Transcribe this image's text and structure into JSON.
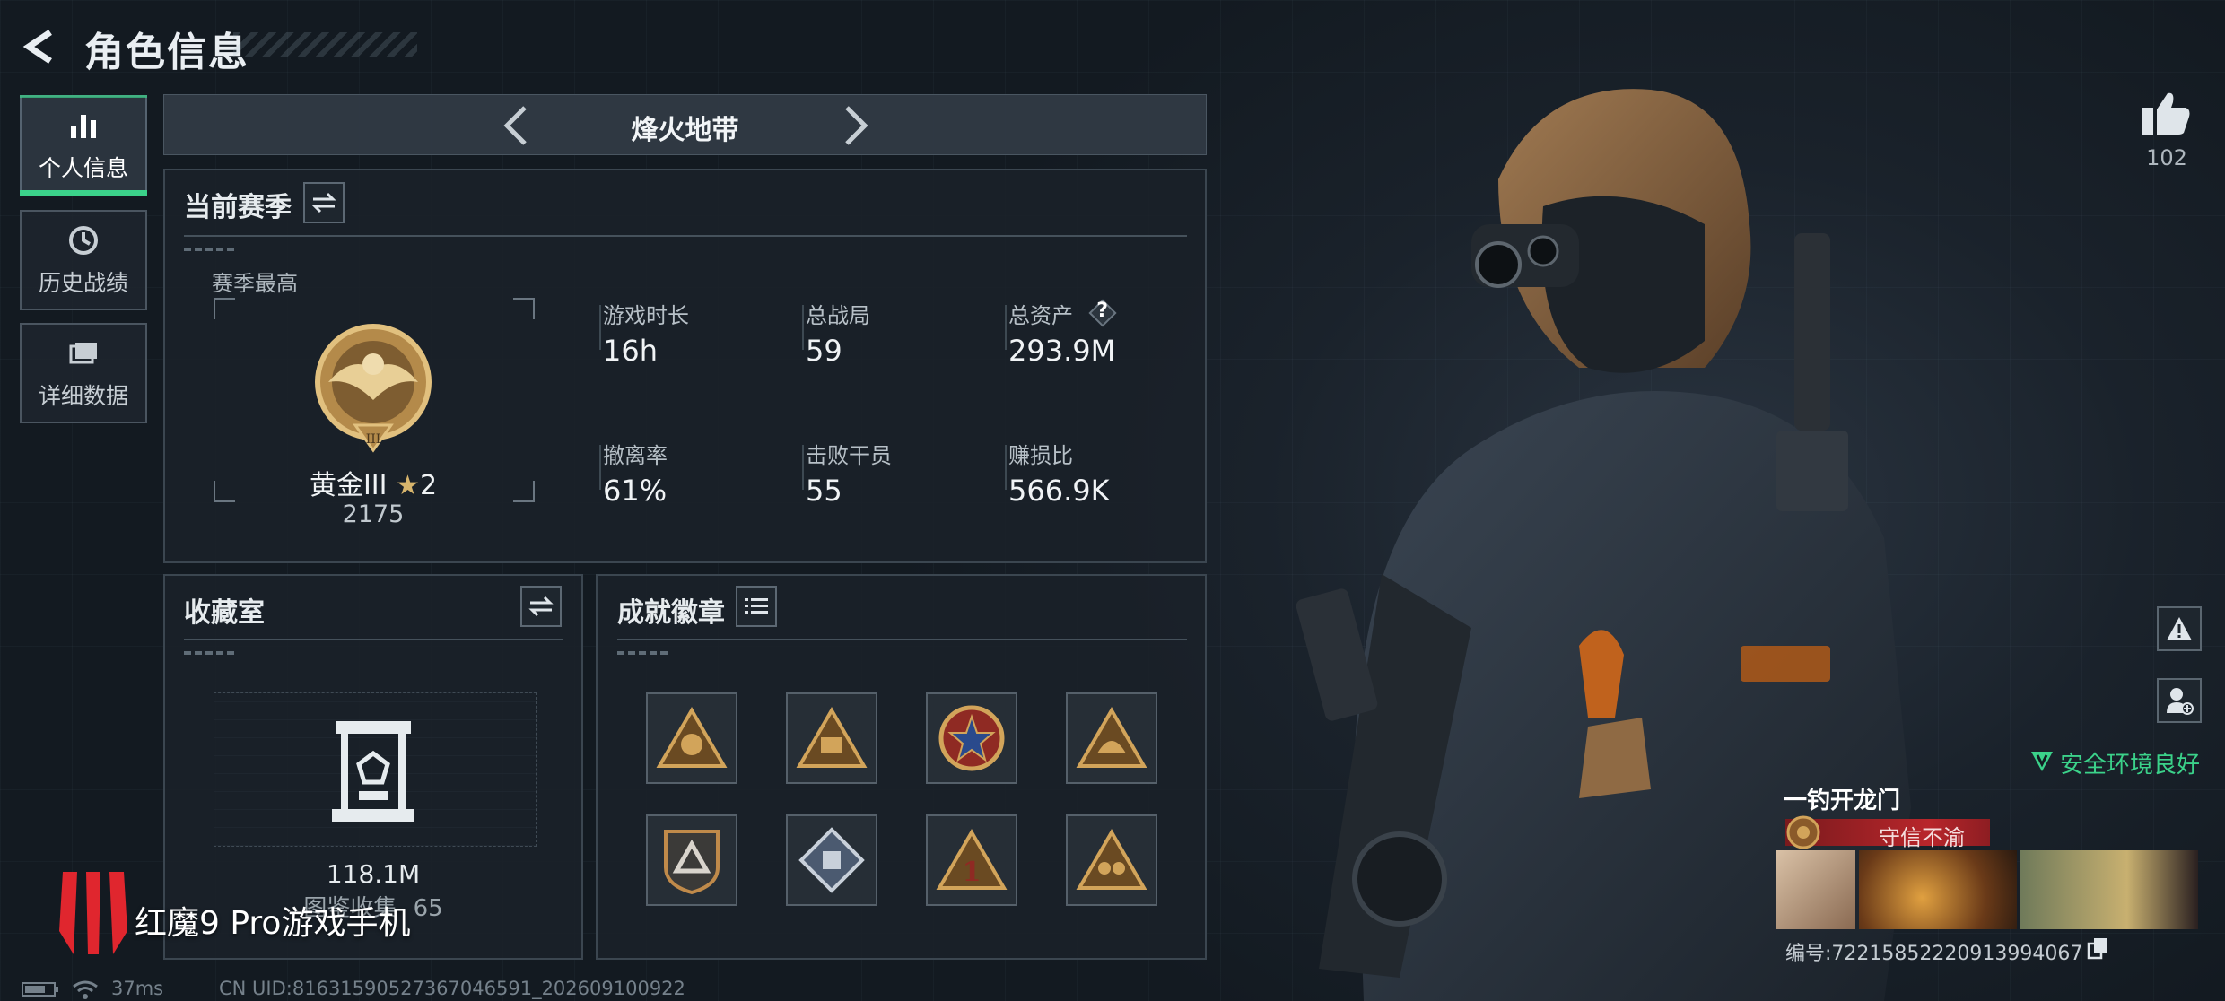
{
  "header": {
    "title": "角色信息"
  },
  "nav": {
    "items": [
      {
        "label": "个人信息",
        "icon": "bar-chart-icon",
        "active": true
      },
      {
        "label": "历史战绩",
        "icon": "clock-history-icon",
        "active": false
      },
      {
        "label": "详细数据",
        "icon": "folder-stack-icon",
        "active": false
      }
    ]
  },
  "mode_selector": {
    "name": "烽火地带"
  },
  "season": {
    "title": "当前赛季",
    "best_label": "赛季最高",
    "rank_name": "黄金III",
    "rank_stars": "2",
    "rank_score": "2175",
    "stats": [
      {
        "label": "游戏时长",
        "value": "16h"
      },
      {
        "label": "总战局",
        "value": "59"
      },
      {
        "label": "总资产",
        "value": "293.9M",
        "help": "?"
      },
      {
        "label": "撤离率",
        "value": "61%"
      },
      {
        "label": "击败干员",
        "value": "55"
      },
      {
        "label": "赚损比",
        "value": "566.9K"
      }
    ]
  },
  "collection": {
    "title": "收藏室",
    "value": "118.1M",
    "sub_label": "图鉴收集",
    "sub_value": "65"
  },
  "badges": {
    "title": "成就徽章",
    "items": [
      "badge-tile-1",
      "badge-tile-2",
      "badge-tile-3",
      "badge-tile-4",
      "badge-tile-5",
      "badge-tile-6",
      "badge-tile-7",
      "badge-tile-8"
    ]
  },
  "right": {
    "likes": "102",
    "safety_text": "安全环境良好",
    "player_name": "一钓开龙门",
    "tag": "守信不渝",
    "uid_label": "编号:72215852220913994067"
  },
  "footer": {
    "ping": "37ms",
    "uid": "CN UID:81631590527367046591_202609100922"
  },
  "watermark": "红魔9 Pro游戏手机",
  "colors": {
    "accent": "#3bd28a",
    "gold": "#c99a4a",
    "tag_red": "#b8262b"
  }
}
